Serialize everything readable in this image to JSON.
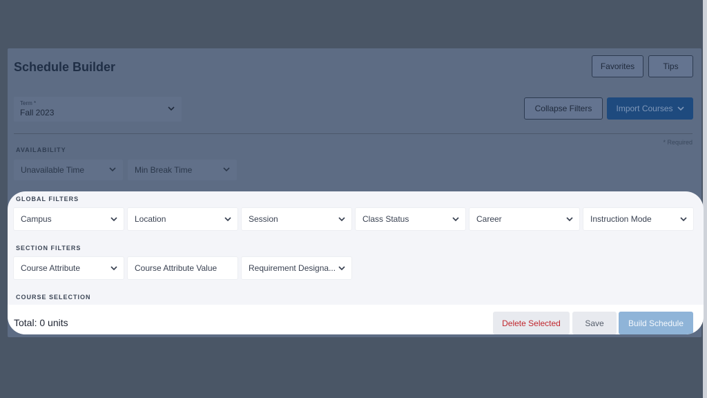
{
  "header": {
    "title": "Schedule Builder",
    "favorites_label": "Favorites",
    "tips_label": "Tips"
  },
  "term": {
    "label": "Term *",
    "value": "Fall 2023"
  },
  "toolbar": {
    "collapse_filters_label": "Collapse Filters",
    "import_courses_label": "Import Courses"
  },
  "required_note": "* Required",
  "availability": {
    "heading": "AVAILABILITY",
    "unavailable_time": "Unavailable Time",
    "min_break_time": "Min Break Time"
  },
  "global_filters": {
    "heading": "GLOBAL FILTERS",
    "items": [
      "Campus",
      "Location",
      "Session",
      "Class Status",
      "Career",
      "Instruction Mode"
    ]
  },
  "section_filters": {
    "heading": "SECTION FILTERS",
    "course_attribute": "Course Attribute",
    "course_attribute_value": "Course Attribute Value",
    "requirement_designation": "Requirement Designa..."
  },
  "course_selection": {
    "heading": "COURSE SELECTION"
  },
  "footer": {
    "total": "Total: 0 units",
    "delete_selected_label": "Delete Selected",
    "save_label": "Save",
    "build_schedule_label": "Build Schedule"
  },
  "colors": {
    "overlay": "#4a5666",
    "highlight_bg": "#f4f5f9",
    "delete_text": "#c0262d",
    "build_button": "#8fb4d8",
    "primary_dim": "#1e4a7e"
  },
  "icons": {
    "dropdown": "chevron-down-icon"
  }
}
